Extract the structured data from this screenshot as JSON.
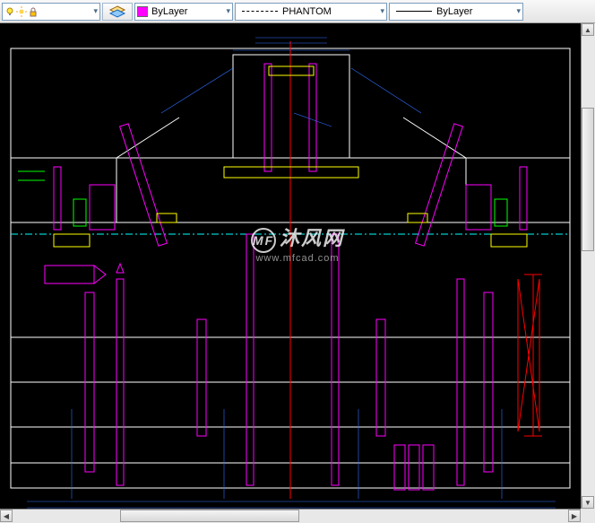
{
  "toolbar": {
    "layer_control": {
      "value": ""
    },
    "color_control": {
      "swatch_color": "#ff00ff",
      "label": "ByLayer"
    },
    "linetype_control": {
      "label": "PHANTOM"
    },
    "lineweight_control": {
      "label": "ByLayer"
    }
  },
  "watermark": {
    "badge": "MF",
    "text": "沐风网",
    "url": "www.mfcad.com"
  },
  "colors": {
    "white": "#ffffff",
    "magenta": "#ff00ff",
    "cyan": "#00ffff",
    "red": "#ff0000",
    "yellow": "#ffff00",
    "green": "#00ff00",
    "blue": "#0000ff"
  }
}
